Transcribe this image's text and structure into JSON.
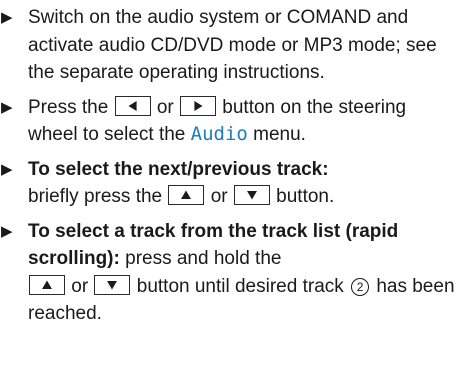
{
  "steps": [
    {
      "text": "Switch on the audio system or COMAND and activate audio CD/DVD mode or MP3 mode; see the separate operating instructions."
    },
    {
      "before": "Press the",
      "or": "or",
      "after": "button on the steering wheel to select the",
      "menu": "Audio",
      "end": "menu.",
      "keys": [
        "left-arrow",
        "right-arrow"
      ]
    },
    {
      "bold": "To select the next/previous track:",
      "text_before": "briefly press the",
      "or": "or",
      "text_after": "button.",
      "keys": [
        "up-arrow",
        "down-arrow"
      ]
    },
    {
      "bold": "To select a track from the track list (rapid scrolling):",
      "text_before": "press and hold the",
      "or": "or",
      "text_mid": "button until desired track",
      "callout": "2",
      "text_after": "has been reached.",
      "keys": [
        "up-arrow",
        "down-arrow"
      ]
    }
  ],
  "colors": {
    "text": "#1a1a1a",
    "menu_name": "#1e7bbf"
  }
}
